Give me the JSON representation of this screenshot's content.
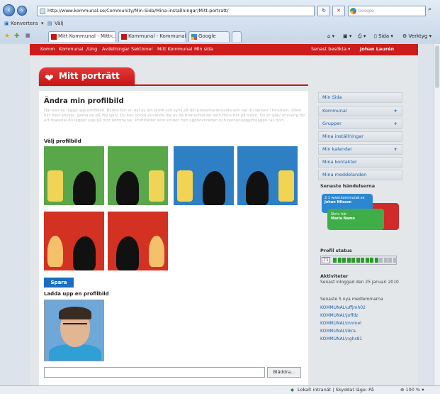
{
  "browser": {
    "address": "http://www.kommunal.se/Community/Min-Sida/Mina-installningar/Mitt-portratt/",
    "search_placeholder": "Google",
    "refresh_icon": "refresh-icon",
    "stop_icon": "stop-icon",
    "command_bar": [
      "Konvertera",
      "Välj"
    ],
    "tabs": [
      {
        "label": "Mitt Kommunal - Mitt ..."
      },
      {
        "label": "Kommunal - Kommunal"
      },
      {
        "label": "Google"
      }
    ],
    "tools": {
      "sida": "Sida",
      "verktyg": "Verktyg"
    },
    "status_zone": "Lokalt intranät | Skyddat läge: På",
    "zoom": "100 %"
  },
  "site_nav": {
    "items": [
      "Komm",
      "Kommunal",
      "/Ung",
      "Avdelningar",
      "Sektioner",
      "Mitt Kommunal",
      "Min sida"
    ],
    "recent": "Senast besökta",
    "user": "Johan Laurén"
  },
  "page": {
    "banner": "Mitt porträtt",
    "title": "Ändra min profilbild",
    "intro": "Här kan du lägga upp profilbild. Bilden blir en del av din profil och syns på din presentationssida och när du skriver i forumen, vilket blir med ansvar, gärna en på dig själv. Du kan också använda dig av de branschbilder som finns här på sidan. Du är själv ansvarig för att material du lägger upp på mitt kommunal. Profilbilder som strider mot upphovsrätten och personuppgiftslagen tas bort.",
    "choose_label": "Välj profilbild",
    "save_button": "Spara",
    "upload_label": "Ladda upp en profilbild",
    "browse_button": "Bläddra..."
  },
  "profile_options": [
    {
      "bg": "#5aa64a",
      "obj": "#f0d455"
    },
    {
      "bg": "#5aa64a",
      "obj": "#f0d455"
    },
    {
      "bg": "#2f7fc4",
      "obj": "#f3d352"
    },
    {
      "bg": "#2f7fc4",
      "obj": "#f3d352"
    },
    {
      "bg": "#d33122",
      "obj": "#f4c06a"
    },
    {
      "bg": "#d33122",
      "obj": "#f4c06a"
    }
  ],
  "sidebar": {
    "items": [
      {
        "label": "Min Sida",
        "plus": ""
      },
      {
        "label": "Kommunal",
        "plus": "+"
      },
      {
        "label": "Grupper",
        "plus": "+"
      },
      {
        "label": "Mina inställningar",
        "plus": ""
      },
      {
        "label": "Min kalender",
        "plus": "+"
      },
      {
        "label": "Mina kontakter",
        "plus": ""
      },
      {
        "label": "Mina meddelanden",
        "plus": ""
      }
    ],
    "events_title": "Senaste händelserna",
    "bubble1": [
      "2.1 www.kommunal.se",
      "Johan Nilsson"
    ],
    "bubble2": [
      "Skriv här",
      "Maria Namn"
    ],
    "profile_status_title": "Profil status",
    "profile_status_value": "71",
    "profile_status_fraction": 0.71,
    "activities_title": "Aktiviteter",
    "last_login": "Senast inloggad den 25 januari 2010",
    "new_members_title": "Senaste 5 nya medlemmarna",
    "members": [
      "KOMMUNAL\\uffjmh02",
      "KOMMUNAL\\joffdz",
      "KOMMUNAL\\mnmel",
      "KOMMUNAL\\likra",
      "KOMMUNAL\\nghs81"
    ]
  }
}
